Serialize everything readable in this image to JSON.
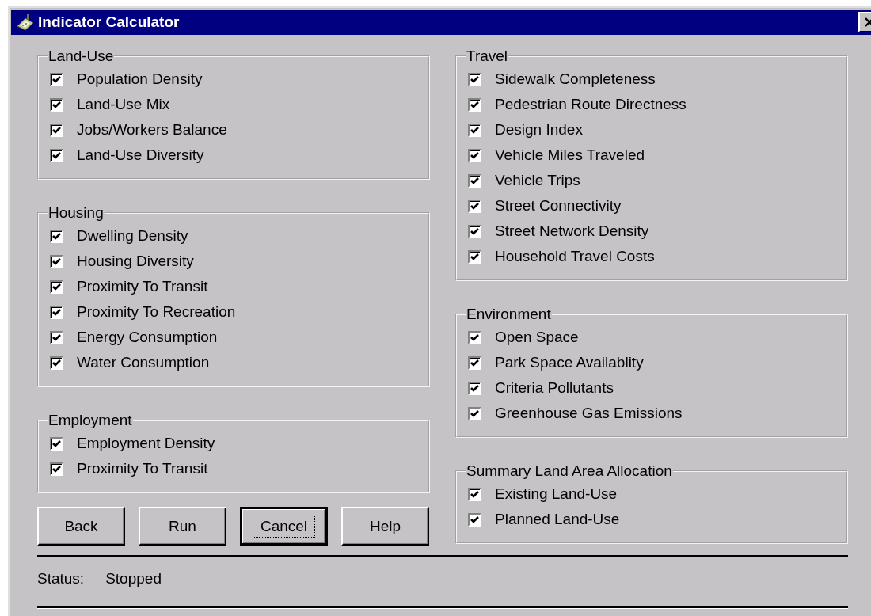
{
  "window": {
    "title": "Indicator Calculator"
  },
  "columns": [
    {
      "groups": [
        {
          "title": "Land-Use",
          "items": [
            {
              "label": "Population Density",
              "checked": true
            },
            {
              "label": "Land-Use Mix",
              "checked": true
            },
            {
              "label": "Jobs/Workers Balance",
              "checked": true
            },
            {
              "label": "Land-Use Diversity",
              "checked": true
            }
          ]
        },
        {
          "title": "Housing",
          "items": [
            {
              "label": "Dwelling Density",
              "checked": true
            },
            {
              "label": "Housing Diversity",
              "checked": true
            },
            {
              "label": "Proximity To Transit",
              "checked": true
            },
            {
              "label": "Proximity To Recreation",
              "checked": true
            },
            {
              "label": "Energy Consumption",
              "checked": true
            },
            {
              "label": "Water Consumption",
              "checked": true
            }
          ]
        },
        {
          "title": "Employment",
          "items": [
            {
              "label": "Employment Density",
              "checked": true
            },
            {
              "label": "Proximity To Transit",
              "checked": true
            }
          ]
        }
      ]
    },
    {
      "groups": [
        {
          "title": "Travel",
          "items": [
            {
              "label": "Sidewalk Completeness",
              "checked": true
            },
            {
              "label": "Pedestrian Route Directness",
              "checked": true
            },
            {
              "label": "Design Index",
              "checked": true
            },
            {
              "label": "Vehicle Miles Traveled",
              "checked": true
            },
            {
              "label": "Vehicle Trips",
              "checked": true
            },
            {
              "label": "Street Connectivity",
              "checked": true
            },
            {
              "label": "Street Network Density",
              "checked": true
            },
            {
              "label": "Household Travel Costs",
              "checked": true
            }
          ]
        },
        {
          "title": "Environment",
          "items": [
            {
              "label": "Open Space",
              "checked": true
            },
            {
              "label": "Park Space Availablity",
              "checked": true
            },
            {
              "label": "Criteria Pollutants",
              "checked": true
            },
            {
              "label": "Greenhouse Gas Emissions",
              "checked": true
            }
          ]
        },
        {
          "title": "Summary Land Area Allocation",
          "items": [
            {
              "label": "Existing Land-Use",
              "checked": true
            },
            {
              "label": "Planned Land-Use",
              "checked": true
            }
          ]
        }
      ]
    }
  ],
  "buttons": [
    {
      "label": "Back",
      "focused": false
    },
    {
      "label": "Run",
      "focused": false
    },
    {
      "label": "Cancel",
      "focused": true
    },
    {
      "label": "Help",
      "focused": false
    }
  ],
  "status": {
    "label": "Status:",
    "value": "Stopped"
  }
}
